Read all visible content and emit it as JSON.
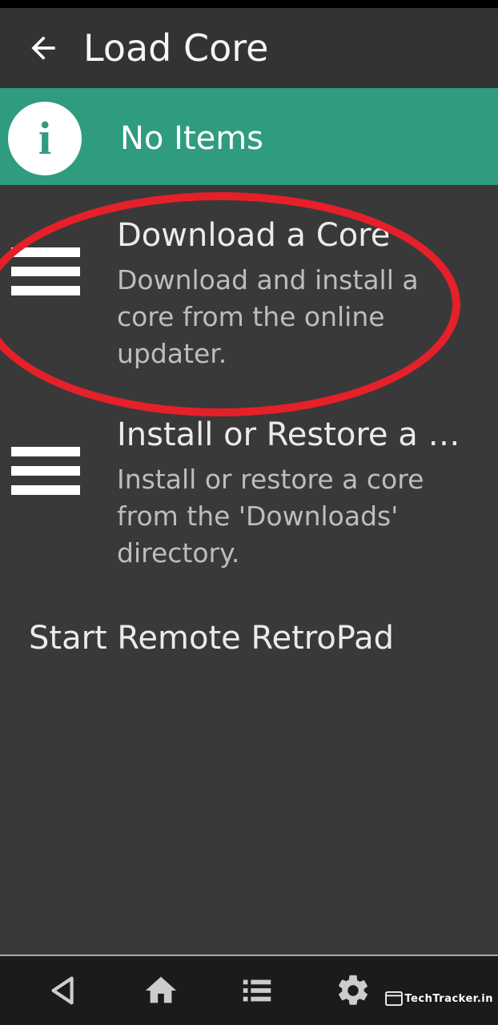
{
  "header": {
    "title": "Load Core"
  },
  "banner": {
    "text": "No Items"
  },
  "items": [
    {
      "title": "Download a Core",
      "desc": "Download and install a core from the online updater."
    },
    {
      "title": "Install or Restore a Core",
      "desc": "Install or restore a core from the 'Downloads' directory."
    }
  ],
  "simple_item": "Start Remote RetroPad",
  "watermark": "TechTracker.in"
}
